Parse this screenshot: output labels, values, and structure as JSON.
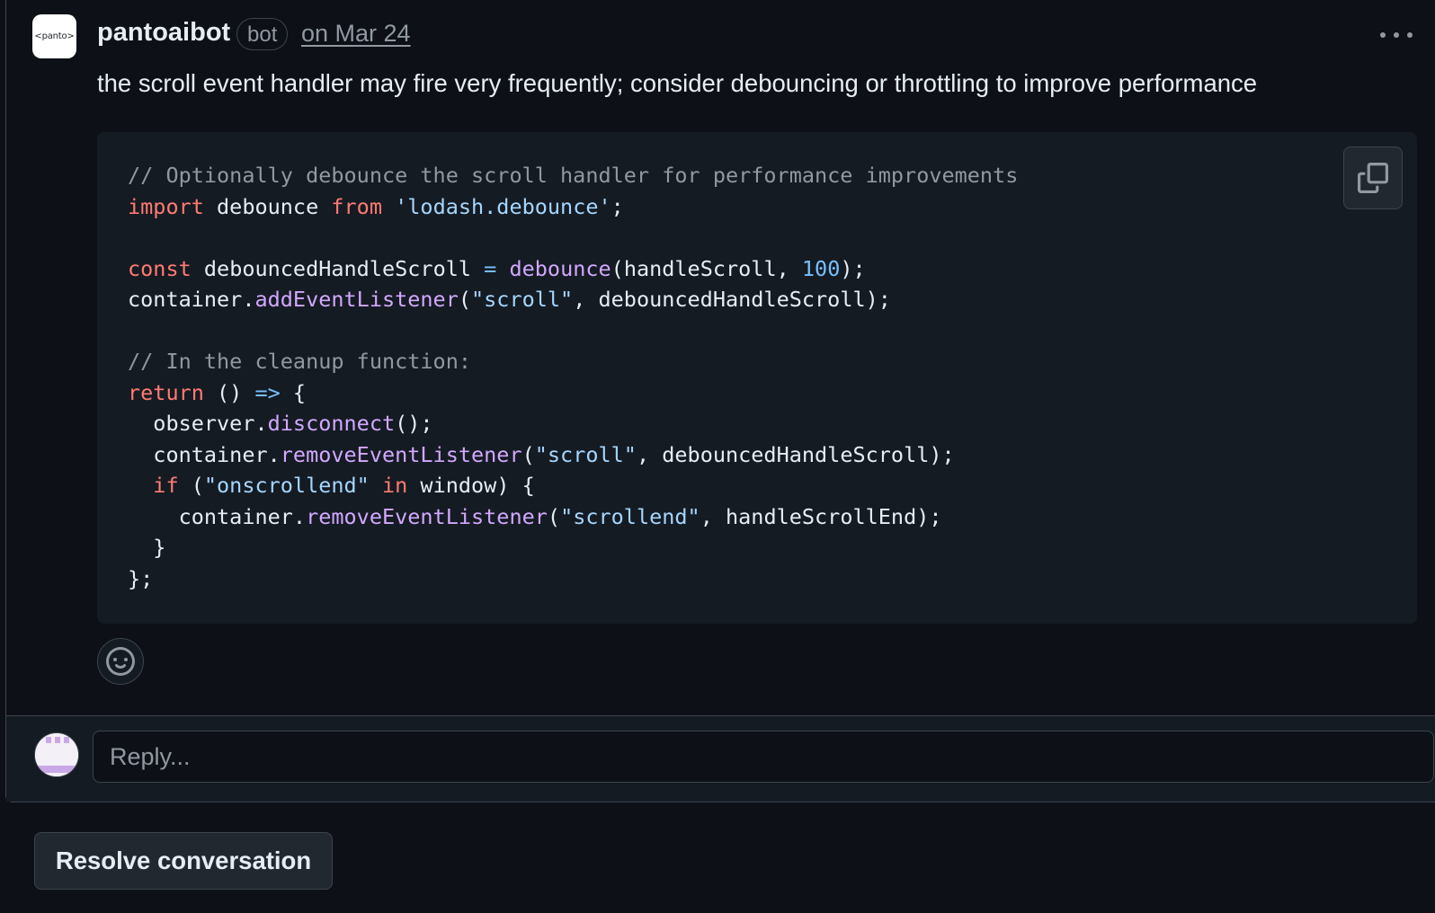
{
  "comment": {
    "avatar_text": "<panto>",
    "author": "pantoaibot",
    "badge": "bot",
    "timestamp": "on Mar 24",
    "body": "the scroll event handler may fire very frequently; consider debouncing or throttling to improve performance",
    "code_lines": [
      "// Optionally debounce the scroll handler for performance improvements",
      "import debounce from 'lodash.debounce';",
      "",
      "const debouncedHandleScroll = debounce(handleScroll, 100);",
      "container.addEventListener(\"scroll\", debouncedHandleScroll);",
      "",
      "// In the cleanup function:",
      "return () => {",
      "  observer.disconnect();",
      "  container.removeEventListener(\"scroll\", debouncedHandleScroll);",
      "  if (\"onscrollend\" in window) {",
      "    container.removeEventListener(\"scrollend\", handleScrollEnd);",
      "  }",
      "};"
    ]
  },
  "icons": {
    "more": "kebab-horizontal-icon",
    "copy": "copy-icon",
    "reaction": "smiley-icon"
  },
  "reply": {
    "placeholder": "Reply..."
  },
  "actions": {
    "resolve_label": "Resolve conversation"
  },
  "colors": {
    "background": "#0d1117",
    "code_background": "#151b23",
    "keyword": "#ff7b72",
    "string": "#a5d6ff",
    "function": "#d2a8ff",
    "number": "#79c0ff",
    "comment": "#9198a1"
  }
}
